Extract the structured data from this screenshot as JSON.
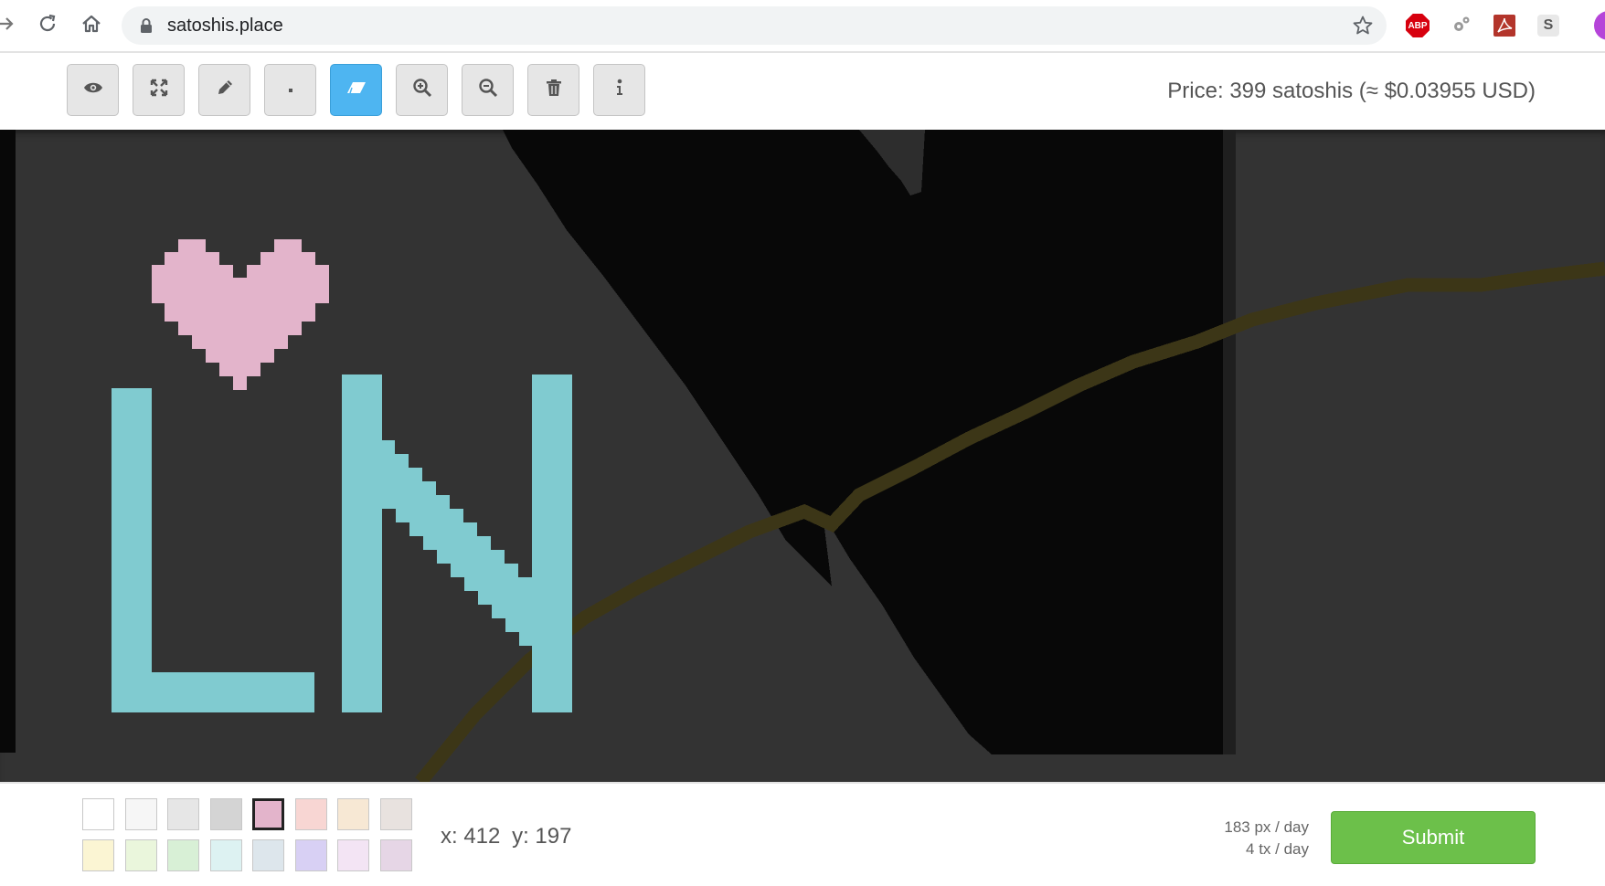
{
  "browser": {
    "url": "satoshis.place",
    "extensions": {
      "abp_label": "ABP",
      "s_label": "S"
    }
  },
  "toolbar": {
    "tools": [
      {
        "name": "view",
        "icon": "eye-icon"
      },
      {
        "name": "fullscreen",
        "icon": "expand-icon"
      },
      {
        "name": "pencil",
        "icon": "pencil-icon"
      },
      {
        "name": "pixel",
        "icon": "dot-icon"
      },
      {
        "name": "eraser",
        "icon": "eraser-icon",
        "active": true
      },
      {
        "name": "zoom-in",
        "icon": "zoom-in-icon"
      },
      {
        "name": "zoom-out",
        "icon": "zoom-out-icon"
      },
      {
        "name": "clear",
        "icon": "trash-icon"
      },
      {
        "name": "info",
        "icon": "info-icon"
      }
    ],
    "price_text": "Price: 399 satoshis (≈ $0.03955 USD)"
  },
  "canvas": {
    "background_color": "#333333",
    "dark_region_color": "#080808",
    "letters_color": "#80cbd0",
    "heart_color": "#e3b4cb",
    "line_color": "#3c3617"
  },
  "palette": {
    "selected_index": 4,
    "colors": [
      "#ffffff",
      "#f6f6f6",
      "#e6e6e6",
      "#d4d4d4",
      "#e3b4cb",
      "#f8d6d3",
      "#f7e8d4",
      "#e8e2df",
      "#fbf5d3",
      "#eaf6dc",
      "#d8f0d6",
      "#ddf2f2",
      "#dde6ec",
      "#d8d0f4",
      "#f3e4f4",
      "#e6d6e6"
    ]
  },
  "status": {
    "x_text": "x: 412",
    "y_text": "y: 197",
    "px_per_day": "183 px / day",
    "tx_per_day": "4 tx / day",
    "submit_label": "Submit"
  }
}
